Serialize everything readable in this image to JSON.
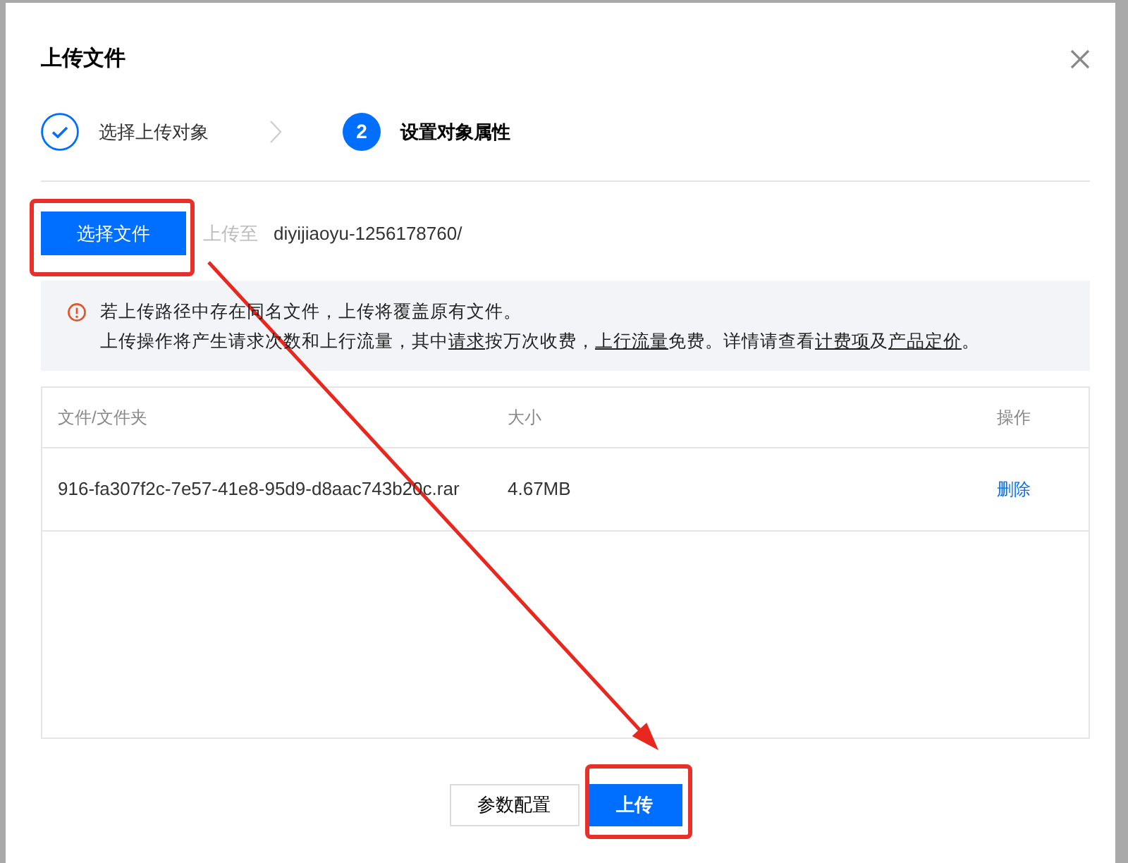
{
  "dialog": {
    "title": "上传文件"
  },
  "steps": [
    {
      "label": "选择上传对象",
      "completed": true,
      "active": false
    },
    {
      "label": "设置对象属性",
      "completed": false,
      "active": true,
      "number": "2"
    }
  ],
  "select_file_button": {
    "label": "选择文件",
    "kind": "select",
    "highlighted": true
  },
  "destination": {
    "label": "上传至",
    "path": "diyijiaoyu-1256178760/"
  },
  "notice": {
    "lines": [
      [
        {
          "text": "若上传路径中存在同名文件，上传将覆盖原有文件。"
        }
      ],
      [
        {
          "text": "上传操作将产生请求次数和上行流量，其中"
        },
        {
          "text": "请求",
          "link": true
        },
        {
          "text": "按万次收费，"
        },
        {
          "text": "上行流量",
          "link": true
        },
        {
          "text": "免费。详情请查看"
        },
        {
          "text": "计费项",
          "link": true
        },
        {
          "text": "及"
        },
        {
          "text": "产品定价",
          "link": true
        },
        {
          "text": "。"
        }
      ]
    ]
  },
  "table": {
    "columns": [
      "文件/文件夹",
      "大小",
      "操作"
    ],
    "rows": [
      {
        "name": "916-fa307f2c-7e57-41e8-95d9-d8aac743b20c.rar",
        "size": "4.67MB",
        "action": "删除"
      }
    ]
  },
  "footer_buttons": [
    {
      "label": "参数配置",
      "kind": "secondary",
      "highlighted": false
    },
    {
      "label": "上传",
      "kind": "primary",
      "highlighted": true
    }
  ],
  "annotation_arrow": true
}
